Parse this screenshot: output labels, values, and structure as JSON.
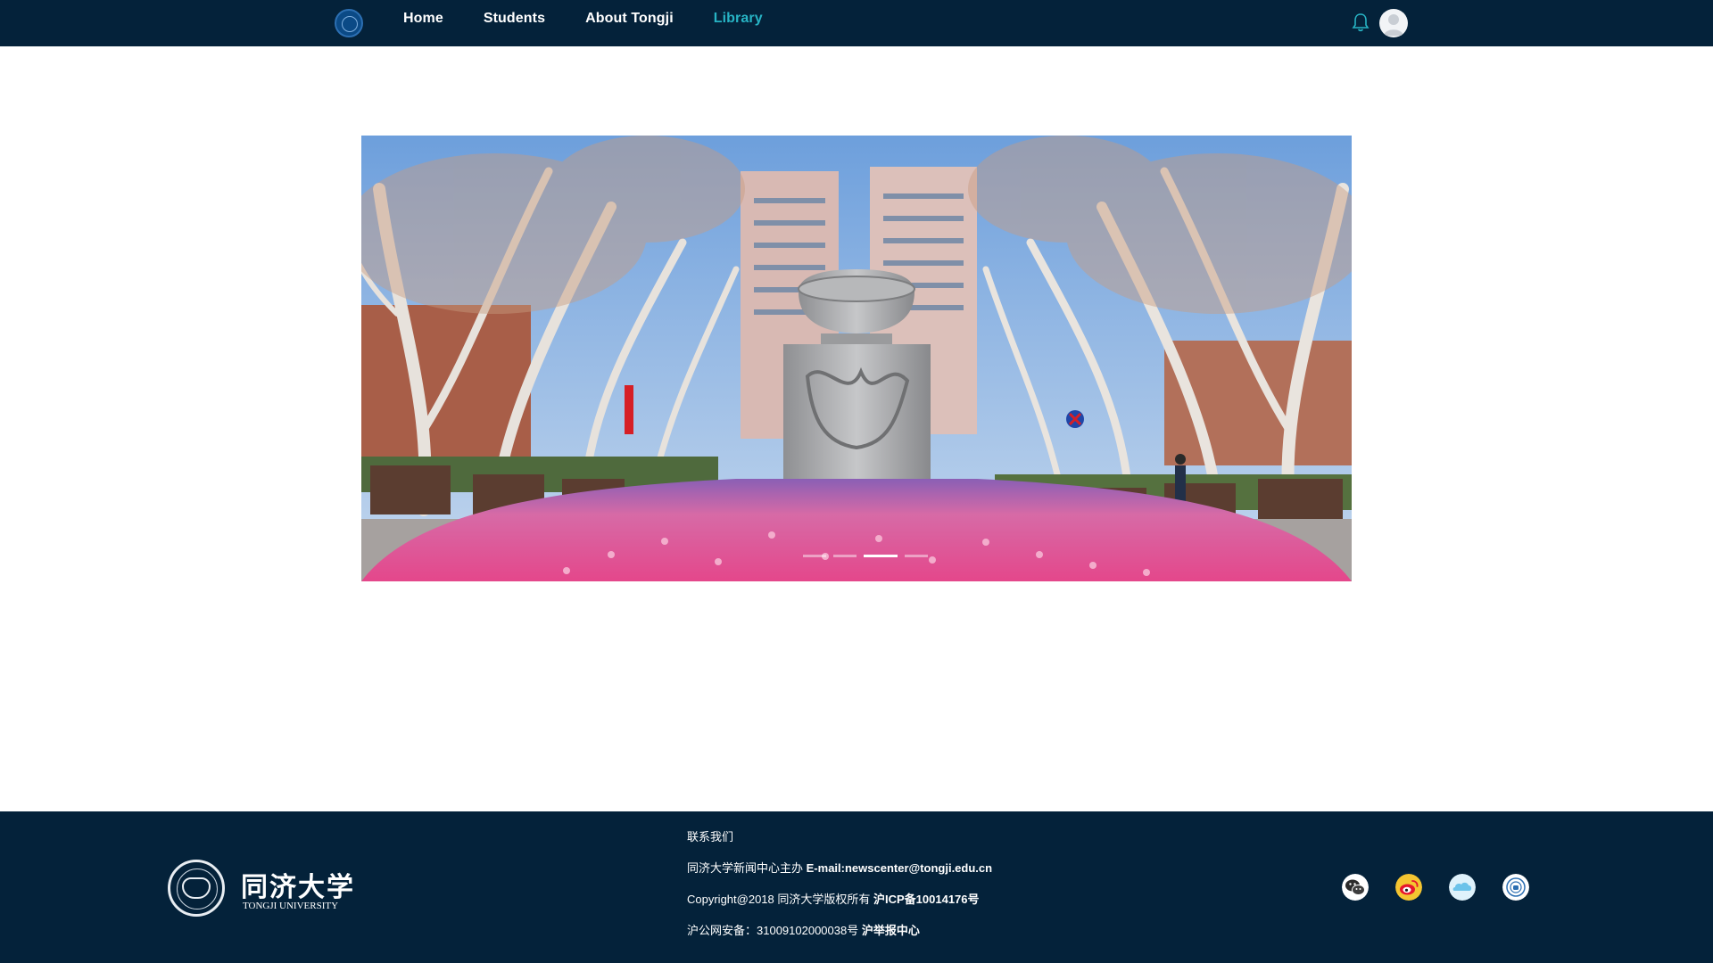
{
  "nav": {
    "logo_icon": "tongji-emblem-icon",
    "links": [
      {
        "label": "Home",
        "active": false
      },
      {
        "label": "Students",
        "active": false
      },
      {
        "label": "About Tongji",
        "active": false
      },
      {
        "label": "Library",
        "active": true
      }
    ],
    "bell_icon": "bell-icon",
    "avatar_icon": "user-avatar-icon"
  },
  "hero": {
    "image": "campus-sculpture-photo",
    "slide_count": 4,
    "active_slide": 3
  },
  "footer": {
    "logo_cn": "同济大学",
    "logo_en": "TONGJI UNIVERSITY",
    "contact_title": "联系我们",
    "line1_prefix": "同济大学新闻中心主办",
    "line1_email": "E-mail:newscenter@tongji.edu.cn",
    "line2_prefix": "Copyright@2018 同济大学版权所有",
    "line2_icp": "沪ICP备10014176号",
    "line3_prefix": "沪公网安备：31009102000038号",
    "line3_report": "沪举报中心",
    "social": [
      "wechat-icon",
      "weibo-icon",
      "cloud-icon",
      "tongji-app-icon"
    ]
  },
  "colors": {
    "nav_bg": "#04223a",
    "active_link": "#27b3c4",
    "footer_bg": "#04223a"
  }
}
